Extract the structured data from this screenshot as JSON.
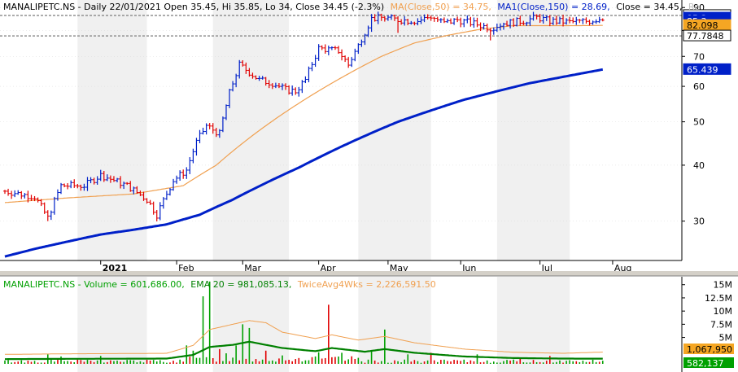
{
  "chart_data": [
    {
      "type": "ohlc",
      "symbol": "MANALIPETC.NS",
      "header_prefix": "MANALIPETC.NS - Daily 22/01/2021 Open 35.45, Hi 35.85, Lo 34, Close 34.45 (-2.3%)",
      "ma50_label": "MA(Close,50) = 34.75,",
      "ma150_label": "MA1(Close,150) = 28.69,",
      "close_label": "Close = 34.45,",
      "header_tail": "Re",
      "y_scale": "log",
      "ylim": [
        24.5,
        92
      ],
      "y_ticks": [
        30,
        40,
        50,
        60,
        70,
        80,
        90
      ],
      "x_labels": [
        {
          "day": 30,
          "label": "2021",
          "bold": true
        },
        {
          "day": 53,
          "label": "Feb"
        },
        {
          "day": 73,
          "label": "Mar"
        },
        {
          "day": 96,
          "label": "Apr"
        },
        {
          "day": 117,
          "label": "May"
        },
        {
          "day": 139,
          "label": "Jun"
        },
        {
          "day": 163,
          "label": "Jul"
        },
        {
          "day": 185,
          "label": "Aug"
        }
      ],
      "day_range": [
        1,
        200
      ],
      "last_day": 182,
      "shaded_months": [
        {
          "start": 23,
          "end": 44
        },
        {
          "start": 64,
          "end": 87
        },
        {
          "start": 108,
          "end": 130
        },
        {
          "start": 150,
          "end": 172
        }
      ],
      "price_path": [
        [
          1,
          35
        ],
        [
          10,
          34
        ],
        [
          14,
          30.5
        ],
        [
          18,
          36
        ],
        [
          25,
          36
        ],
        [
          30,
          38
        ],
        [
          38,
          36
        ],
        [
          44,
          33.5
        ],
        [
          47,
          31
        ],
        [
          52,
          37
        ],
        [
          56,
          39
        ],
        [
          59,
          45
        ],
        [
          62,
          49
        ],
        [
          66,
          47
        ],
        [
          69,
          58
        ],
        [
          72,
          67
        ],
        [
          78,
          62
        ],
        [
          82,
          61
        ],
        [
          86,
          59
        ],
        [
          89,
          58.5
        ],
        [
          92,
          62
        ],
        [
          96,
          73
        ],
        [
          102,
          72
        ],
        [
          105,
          67
        ],
        [
          108,
          74
        ],
        [
          112,
          85
        ],
        [
          116,
          85.5
        ],
        [
          120,
          84.5
        ],
        [
          126,
          84
        ],
        [
          130,
          86
        ],
        [
          134,
          83
        ],
        [
          138,
          84.5
        ],
        [
          144,
          82.5
        ],
        [
          148,
          81
        ],
        [
          152,
          83
        ],
        [
          158,
          84
        ],
        [
          162,
          85.5
        ],
        [
          166,
          84
        ],
        [
          172,
          83.5
        ],
        [
          178,
          84
        ],
        [
          182,
          85.3
        ]
      ],
      "price_dips": [
        [
          14,
          30
        ],
        [
          47,
          30.8
        ],
        [
          105,
          66
        ],
        [
          120,
          79
        ],
        [
          148,
          76
        ]
      ],
      "series": [
        {
          "name": "MA(Close,50)",
          "color": "#f0a050",
          "values": [
            [
              1,
              33
            ],
            [
              20,
              33.8
            ],
            [
              40,
              34.5
            ],
            [
              55,
              36
            ],
            [
              65,
              40
            ],
            [
              75,
              46
            ],
            [
              85,
              52
            ],
            [
              95,
              58
            ],
            [
              105,
              64
            ],
            [
              115,
              70
            ],
            [
              125,
              75
            ],
            [
              135,
              78
            ],
            [
              145,
              80.5
            ],
            [
              155,
              82
            ],
            [
              165,
              82
            ],
            [
              175,
              82
            ],
            [
              182,
              82.098
            ]
          ]
        },
        {
          "name": "MA1(Close,150)",
          "color": "#0020c8",
          "values": [
            [
              1,
              25
            ],
            [
              10,
              26
            ],
            [
              20,
              27
            ],
            [
              30,
              28
            ],
            [
              40,
              28.7
            ],
            [
              50,
              29.5
            ],
            [
              60,
              31
            ],
            [
              70,
              33.5
            ],
            [
              80,
              36.5
            ],
            [
              90,
              39.5
            ],
            [
              100,
              43
            ],
            [
              110,
              46.5
            ],
            [
              120,
              50
            ],
            [
              130,
              53
            ],
            [
              140,
              56
            ],
            [
              150,
              58.5
            ],
            [
              160,
              61
            ],
            [
              170,
              63
            ],
            [
              182,
              65.439
            ]
          ]
        }
      ],
      "price_tags": [
        {
          "value": "86.4152",
          "y": 86.4152,
          "bg": "#ffffff",
          "fg": "#000000",
          "border": "#000000"
        },
        {
          "value": "85.3",
          "y": 85.3,
          "bg": "#0020c8",
          "fg": "#ffffff"
        },
        {
          "value": "85.3",
          "y": 83.9,
          "bg": "#0020c8",
          "fg": "#ffffff"
        },
        {
          "value": "82.098",
          "y": 82.098,
          "bg": "#f5a623",
          "fg": "#000000"
        },
        {
          "value": "77.7848",
          "y": 77.7848,
          "bg": "#ffffff",
          "fg": "#000000",
          "border": "#000000"
        },
        {
          "value": "65.439",
          "y": 65.439,
          "bg": "#0020c8",
          "fg": "#ffffff"
        }
      ],
      "ref_lines": [
        86.4152,
        77.7848
      ],
      "colors": {
        "up": "#0020c8",
        "down": "#e00000",
        "ma50": "#f0a050",
        "ma150": "#0020c8",
        "shade": "#f0f0f0",
        "grid": "#d8d8d8",
        "refline": "#909090"
      }
    },
    {
      "type": "bar",
      "header_prefix": "MANALIPETC.NS - Volume = 601,686.00,",
      "ema_label": "EMA 20 = 981,085.13,",
      "twice_label": "TwiceAvg4Wks = 2,226,591.50",
      "ylim": [
        0,
        16500000
      ],
      "y_ticks": [
        {
          "value": 15000000,
          "label": "15M"
        },
        {
          "value": 12500000,
          "label": "12.5M"
        },
        {
          "value": 10000000,
          "label": "10M"
        },
        {
          "value": 7500000,
          "label": "7.5M"
        },
        {
          "value": 5000000,
          "label": "5M"
        }
      ],
      "spikes": [
        [
          14,
          1.8
        ],
        [
          18,
          1.4
        ],
        [
          30,
          1.5
        ],
        [
          56,
          3.5
        ],
        [
          58,
          2.5
        ],
        [
          61,
          12.8
        ],
        [
          63,
          15.6
        ],
        [
          66,
          2.8
        ],
        [
          68,
          2.0
        ],
        [
          71,
          3.5
        ],
        [
          73,
          7.5
        ],
        [
          75,
          6.8
        ],
        [
          80,
          2.5
        ],
        [
          85,
          1.6
        ],
        [
          96,
          2.2
        ],
        [
          99,
          11.2
        ],
        [
          103,
          2.1
        ],
        [
          112,
          2.4
        ],
        [
          116,
          6.5
        ],
        [
          123,
          1.8
        ],
        [
          130,
          2.1
        ],
        [
          144,
          1.8
        ],
        [
          157,
          1.2
        ],
        [
          166,
          1.5
        ]
      ],
      "down_spikes": [
        99,
        66,
        80,
        130,
        157,
        166
      ],
      "ema_path": [
        [
          1,
          0.9
        ],
        [
          20,
          0.95
        ],
        [
          50,
          1.0
        ],
        [
          58,
          1.7
        ],
        [
          63,
          3.2
        ],
        [
          70,
          3.6
        ],
        [
          75,
          4.2
        ],
        [
          85,
          3.0
        ],
        [
          95,
          2.4
        ],
        [
          100,
          3.0
        ],
        [
          110,
          2.3
        ],
        [
          116,
          2.8
        ],
        [
          125,
          2.1
        ],
        [
          140,
          1.4
        ],
        [
          155,
          1.1
        ],
        [
          170,
          1.0
        ],
        [
          182,
          0.98
        ]
      ],
      "twice_path": [
        [
          1,
          1.8
        ],
        [
          20,
          1.9
        ],
        [
          50,
          2.0
        ],
        [
          58,
          3.5
        ],
        [
          63,
          6.5
        ],
        [
          70,
          7.5
        ],
        [
          75,
          8.2
        ],
        [
          80,
          7.8
        ],
        [
          85,
          6.0
        ],
        [
          95,
          4.8
        ],
        [
          100,
          5.5
        ],
        [
          108,
          4.5
        ],
        [
          116,
          5.2
        ],
        [
          125,
          4.0
        ],
        [
          140,
          2.8
        ],
        [
          155,
          2.2
        ],
        [
          170,
          2.0
        ],
        [
          182,
          2.23
        ]
      ],
      "value_tags": [
        {
          "value": "1,067,950",
          "y": 1067950,
          "bg": "#f5a623",
          "fg": "#000000"
        },
        {
          "value": "582,137",
          "y": 582137,
          "bg": "#00a000",
          "fg": "#ffffff"
        }
      ],
      "colors": {
        "up": "#00a000",
        "down": "#e00000",
        "ema": "#008000",
        "twice": "#f0a050"
      }
    }
  ]
}
